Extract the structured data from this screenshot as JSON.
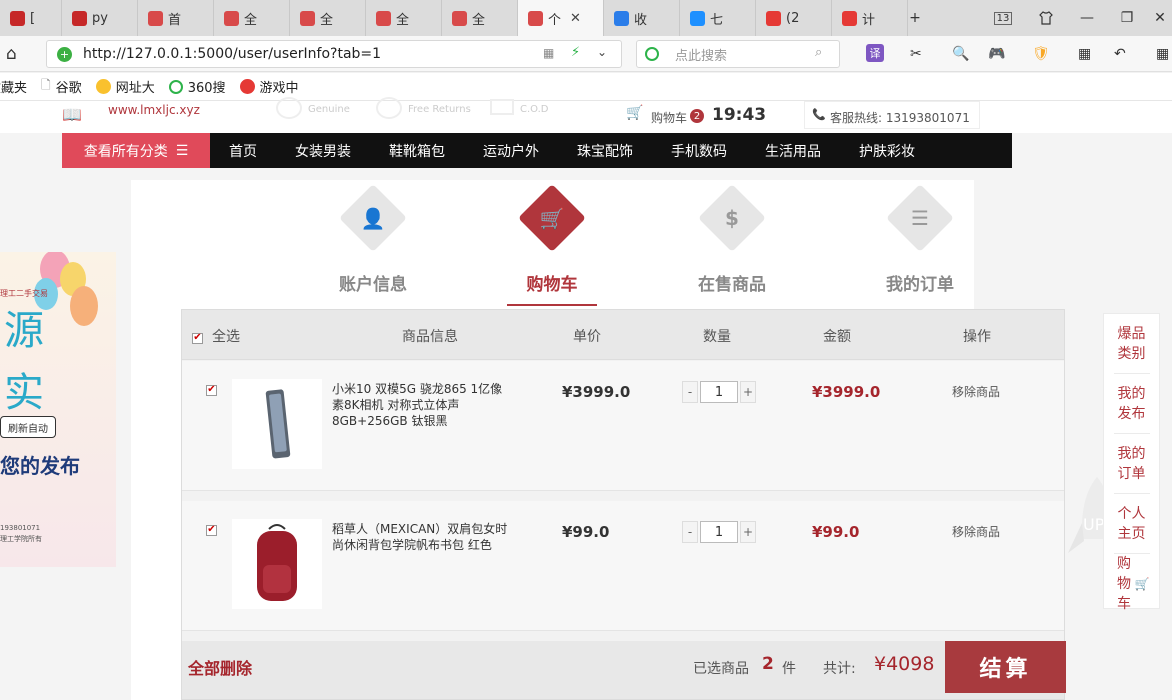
{
  "browser": {
    "tabs": [
      {
        "label": "[",
        "icon": "csdn-icon",
        "color": "#c62828"
      },
      {
        "label": "py",
        "icon": "csdn-icon",
        "color": "#c62828"
      },
      {
        "label": "首",
        "icon": "site-icon",
        "color": "#d84a4a"
      },
      {
        "label": "全",
        "icon": "site-icon",
        "color": "#d84a4a"
      },
      {
        "label": "全",
        "icon": "site-icon",
        "color": "#d84a4a"
      },
      {
        "label": "全",
        "icon": "site-icon",
        "color": "#d84a4a"
      },
      {
        "label": "全",
        "icon": "site-icon",
        "color": "#d84a4a"
      },
      {
        "label": "个",
        "icon": "site-icon",
        "color": "#d84a4a"
      },
      {
        "label": "收",
        "icon": "chrome-icon",
        "color": "#2b7de9"
      },
      {
        "label": "七",
        "icon": "bird-icon",
        "color": "#1e90ff"
      },
      {
        "label": "(2",
        "icon": "yi-icon",
        "color": "#e53935"
      },
      {
        "label": "计",
        "icon": "flag-icon",
        "color": "#e53935"
      }
    ],
    "new_tab": "+",
    "tab_count": "13",
    "url": "http://127.0.0.1:5000/user/userInfo?tab=1",
    "search_placeholder": "点此搜索",
    "translate_label": "译",
    "bookmarks": [
      {
        "label": "收藏夹"
      },
      {
        "label": "谷歌"
      },
      {
        "label": "网址大"
      },
      {
        "label": "360搜"
      },
      {
        "label": "游戏中"
      }
    ]
  },
  "site": {
    "logo_text": "www.lmxljc.xyz",
    "badges": [
      "Genuine",
      "Free Returns",
      "C.O.D"
    ],
    "cart_label": "购物车",
    "cart_count": "2",
    "time": "19:43",
    "hotline": "客服热线: 13193801071",
    "nav": {
      "all": "查看所有分类",
      "items": [
        "首页",
        "女装男装",
        "鞋靴箱包",
        "运动户外",
        "珠宝配饰",
        "手机数码",
        "生活用品",
        "护肤彩妆"
      ]
    }
  },
  "banner": {
    "line1": "理工二手交易",
    "big1": "源",
    "big2": "实",
    "button": "刷新自动",
    "line2": "您的发布",
    "phone": "193801071",
    "footer": "理工学院所有"
  },
  "user_tabs": [
    {
      "label": "账户信息",
      "icon": "user-icon",
      "glyph": "👤"
    },
    {
      "label": "购物车",
      "icon": "cart-icon",
      "glyph": "🛒"
    },
    {
      "label": "在售商品",
      "icon": "dollar-icon",
      "glyph": "$"
    },
    {
      "label": "我的订单",
      "icon": "list-icon",
      "glyph": "☰"
    }
  ],
  "cart": {
    "headers": {
      "select_all": "全选",
      "info": "商品信息",
      "price": "单价",
      "qty": "数量",
      "amount": "金额",
      "action": "操作"
    },
    "items": [
      {
        "name": "小米10 双模5G 骁龙865 1亿像素8K相机 对称式立体声 8GB+256GB 钛银黑",
        "price": "¥3999.0",
        "qty": "1",
        "amount": "¥3999.0",
        "remove": "移除商品",
        "minus": "-",
        "plus": "+"
      },
      {
        "name": "稻草人（MEXICAN）双肩包女时尚休闲背包学院帆布书包 红色",
        "price": "¥99.0",
        "qty": "1",
        "amount": "¥99.0",
        "remove": "移除商品",
        "minus": "-",
        "plus": "+"
      }
    ],
    "footer": {
      "delete_all": "全部删除",
      "selected_label": "已选商品",
      "selected_count": "2",
      "unit": "件",
      "total_label": "共计:",
      "total": "¥4098",
      "checkout": "结算"
    }
  },
  "side_menu": [
    "爆品类别",
    "我的发布",
    "我的订单",
    "个人主页",
    "购物车"
  ],
  "up_label": "UP",
  "colors": {
    "accent": "#b0363c",
    "nav_all": "#e04a5a",
    "checkout": "#a83a3e"
  }
}
